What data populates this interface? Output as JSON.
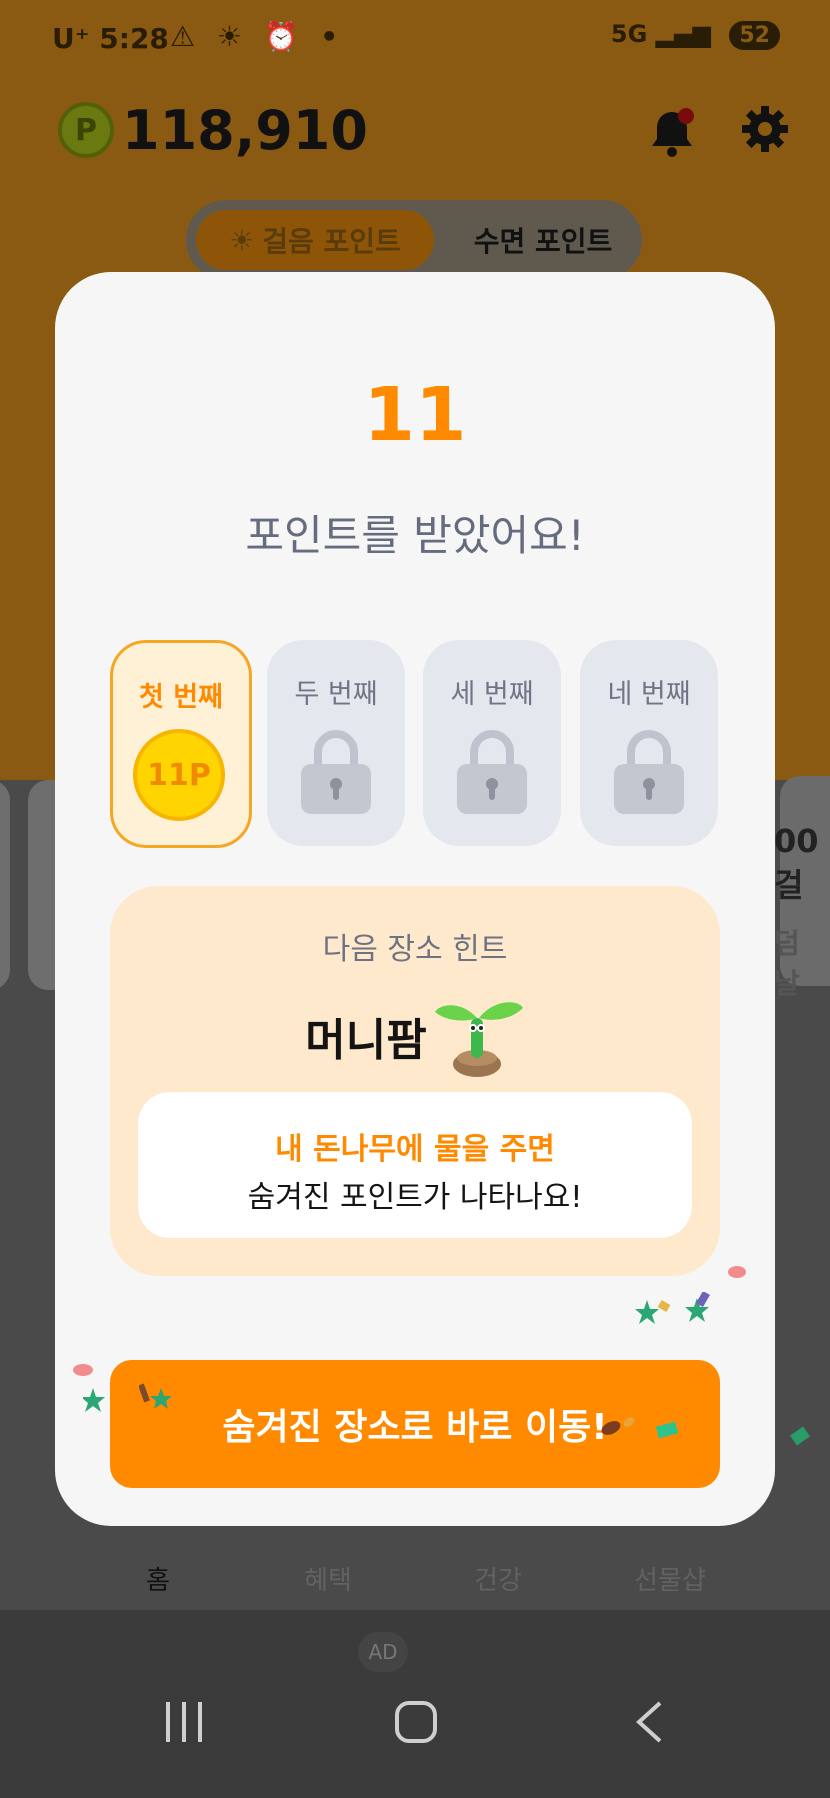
{
  "status_bar": {
    "carrier": "U⁺",
    "time": "5:28",
    "icons": "⚠ ☀ ⏰ •",
    "network": "5G",
    "battery": "52"
  },
  "header": {
    "coin_symbol": "P",
    "points": "118,910",
    "bell_icon": "bell-icon",
    "settings_icon": "gear-icon"
  },
  "segmented": {
    "walk_label": "걸음 포인트",
    "sleep_label": "수면 포인트"
  },
  "background_cards": {
    "right_text_1": "00 걸",
    "right_text_2": "덤 날"
  },
  "modal": {
    "count": "11",
    "title": "포인트를 받았어요!",
    "steps": [
      {
        "label": "첫 번째",
        "reward": "11P",
        "state": "unlocked"
      },
      {
        "label": "두 번째",
        "state": "locked"
      },
      {
        "label": "세 번째",
        "state": "locked"
      },
      {
        "label": "네 번째",
        "state": "locked"
      }
    ],
    "hint": {
      "label": "다음 장소 힌트",
      "place": "머니팜",
      "line1": "내 돈나무에 물을 주면",
      "line2": "숨겨진 포인트가 나타나요!"
    },
    "cta_label": "숨겨진 장소로 바로 이동!"
  },
  "bottom_nav": {
    "items": [
      {
        "label": "홈"
      },
      {
        "label": "혜택"
      },
      {
        "label": "건강"
      },
      {
        "label": "선물샵"
      }
    ]
  },
  "ad_label": "AD",
  "colors": {
    "accent": "#ff8a00",
    "modal_bg": "#f6f6f6",
    "hint_bg": "#ffe9cc",
    "locked_bg": "#e5e7ef"
  }
}
